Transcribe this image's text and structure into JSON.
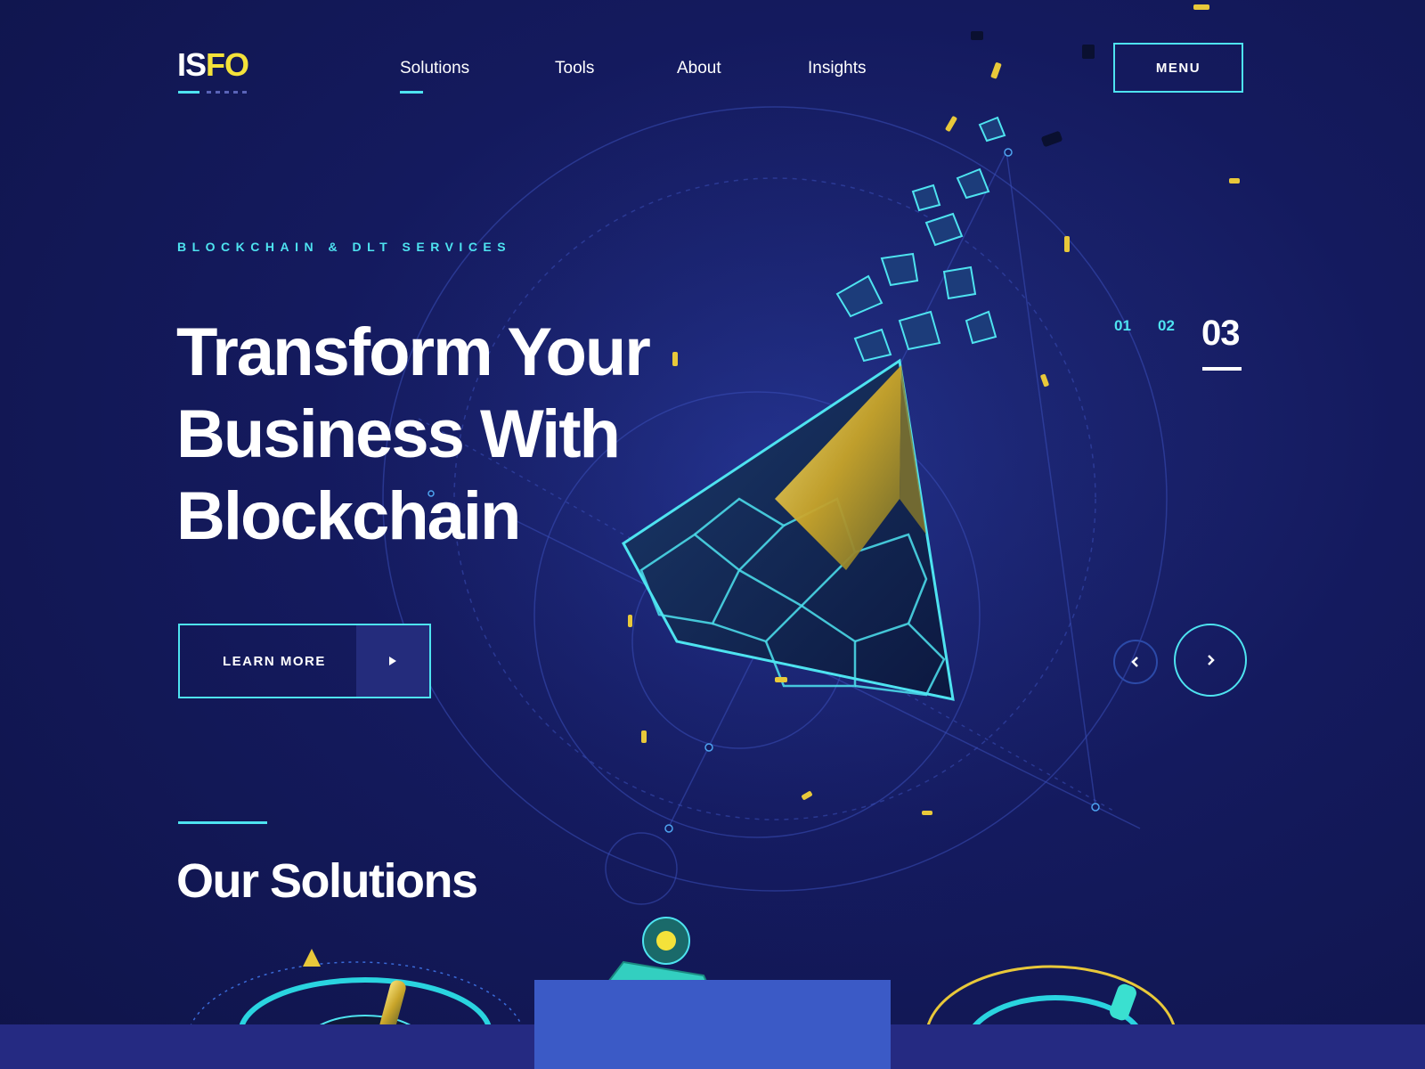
{
  "header": {
    "logo": {
      "part1": "IS",
      "part2": "FO"
    },
    "nav": [
      {
        "label": "Solutions",
        "active": true
      },
      {
        "label": "Tools",
        "active": false
      },
      {
        "label": "About",
        "active": false
      },
      {
        "label": "Insights",
        "active": false
      }
    ],
    "menu_label": "MENU"
  },
  "hero": {
    "eyebrow": "BLOCKCHAIN & DLT SERVICES",
    "title_lines": [
      "Transform Your",
      "Business With",
      "Blockchain"
    ],
    "cta_label": "LEARN MORE",
    "cta_icon": "play-arrow-icon"
  },
  "slider": {
    "slides": [
      "01",
      "02",
      "03"
    ],
    "active_index": 2,
    "prev_icon": "chevron-left-icon",
    "next_icon": "chevron-right-icon"
  },
  "solutions": {
    "title": "Our Solutions"
  },
  "colors": {
    "accent_cyan": "#4ee3f0",
    "logo_yellow": "#f4e23a",
    "background": "#141a5e",
    "card_blue": "#3b5ac6"
  }
}
